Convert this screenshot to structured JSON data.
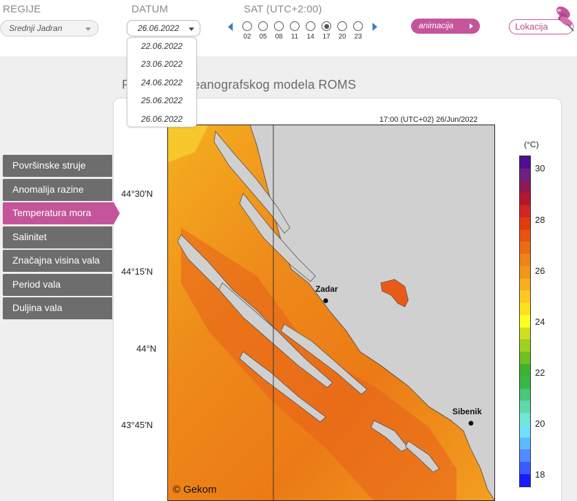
{
  "header": {
    "region_label": "REGIJE",
    "region_value": "Srednji Jadran",
    "date_label": "DATUM",
    "date_value": "26.06.2022",
    "date_options": [
      "22.06.2022",
      "23.06.2022",
      "24.06.2022",
      "25.06.2022",
      "26.06.2022"
    ],
    "hour_label": "SAT (UTC+2:00)",
    "hours": [
      "02",
      "05",
      "08",
      "11",
      "14",
      "17",
      "20",
      "23"
    ],
    "selected_hour": "17",
    "animation_label": "animacija",
    "location_label": "Lokacija"
  },
  "main": {
    "title": "Prognoza oceanografskog modela ROMS",
    "timestamp": "17:00 (UTC+02)  26/Jun/2022",
    "copyright": "© Gekom"
  },
  "sidebar": {
    "items": [
      {
        "label": "Površinske struje",
        "active": false
      },
      {
        "label": "Anomalija razine",
        "active": false
      },
      {
        "label": "Temperatura mora",
        "active": true
      },
      {
        "label": "Salinitet",
        "active": false
      },
      {
        "label": "Značajna visina vala",
        "active": false
      },
      {
        "label": "Period vala",
        "active": false
      },
      {
        "label": "Duljina vala",
        "active": false
      }
    ]
  },
  "map": {
    "latitude_labels": [
      "44°30'N",
      "44°15'N",
      "44°N",
      "43°45'N"
    ],
    "cities": [
      "Zadar",
      "Sibenik"
    ],
    "colorbar_unit": "(°C)",
    "colorbar_labels": [
      "30",
      "28",
      "26",
      "24",
      "22",
      "20",
      "18"
    ],
    "colorbar_colors": [
      "#1a1aff",
      "#3a5cff",
      "#4f8cff",
      "#60b8ff",
      "#6fe0ff",
      "#6fe8d8",
      "#5ed9a8",
      "#48c878",
      "#38b848",
      "#40b030",
      "#70c020",
      "#a0d020",
      "#d0e020",
      "#ffff20",
      "#ffe020",
      "#ffc820",
      "#f8b020",
      "#f09818",
      "#f08418",
      "#ec6c14",
      "#e85410",
      "#e03c10",
      "#d02820",
      "#b01830",
      "#901850",
      "#702080",
      "#4c1090"
    ],
    "land_color": "#d2d2d2",
    "sea_color": "#f08a1a"
  }
}
